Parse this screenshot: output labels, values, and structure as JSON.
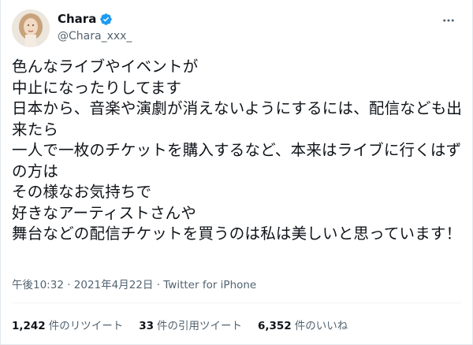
{
  "author": {
    "display_name": "Chara",
    "handle": "@Chara_xxx_",
    "verified": true,
    "avatar": "portrait-photo"
  },
  "more_icon": "ellipsis-icon",
  "tweet": {
    "text": "色んなライブやイベントが\n中止になったりしてます\n日本から、音楽や演劇が消えないようにするには、配信なども出来たら\n一人で一枚のチケットを購入するなど、本来はライブに行くはずの方は\nその様なお気持ちで\n好きなアーティストさんや\n舞台などの配信チケットを買うのは私は美しいと思っています！",
    "time": "午後10:32",
    "separator": " · ",
    "date": "2021年4月22日",
    "app": "Twitter for iPhone"
  },
  "stats": {
    "retweets": {
      "count": "1,242",
      "label": "件のリツイート"
    },
    "quotes": {
      "count": "33",
      "label": "件の引用ツイート"
    },
    "likes": {
      "count": "6,352",
      "label": "件のいいね"
    }
  },
  "colors": {
    "text": "#0f1419",
    "secondary": "#536471",
    "verified": "#1d9bf0",
    "divider": "#eff3f4"
  }
}
